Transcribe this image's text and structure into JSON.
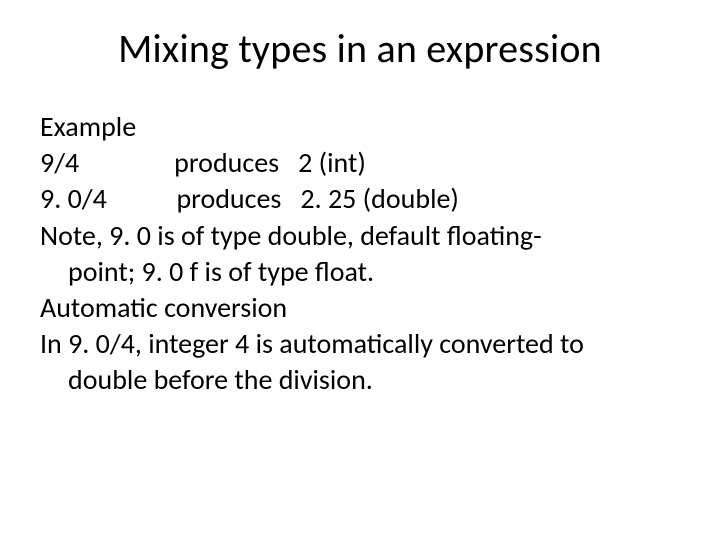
{
  "title": "Mixing types in an expression",
  "example_label": "Example",
  "rows": [
    {
      "expr": "9/4",
      "verb": "produces",
      "result": "2 (int)"
    },
    {
      "expr": "9. 0/4",
      "verb": "produces",
      "result": "2. 25 (double)"
    }
  ],
  "note_line1": "Note, 9. 0 is of type double, default floating-",
  "note_line2": "point; 9. 0 f is of type float.",
  "auto_label": "Automatic conversion",
  "auto_line1": "In 9. 0/4, integer 4 is automatically converted to",
  "auto_line2": "double before the division."
}
